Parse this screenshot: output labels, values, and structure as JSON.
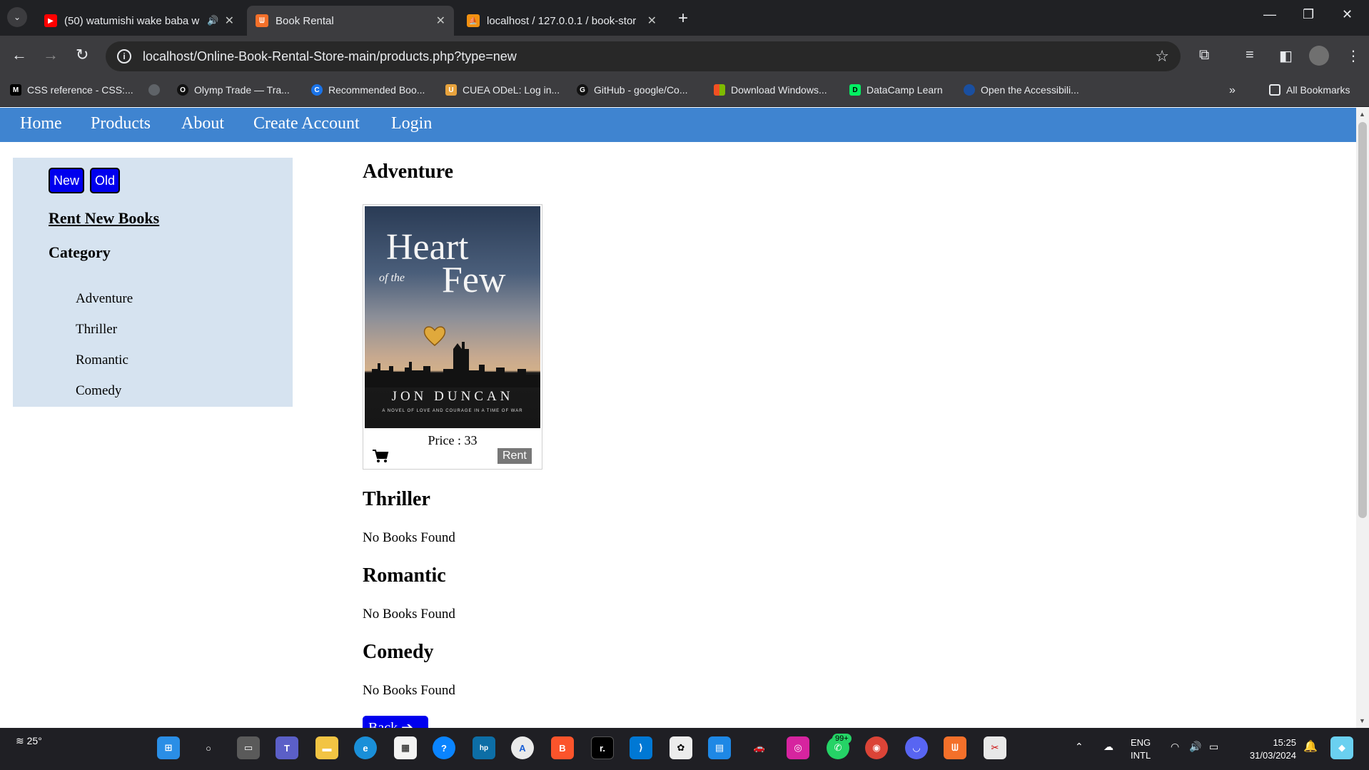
{
  "browser": {
    "tabs": [
      {
        "title": "(50) watumishi wake baba w",
        "favicon_color": "#ff0000"
      },
      {
        "title": "Book Rental",
        "favicon_color": "#f4702a"
      },
      {
        "title": "localhost / 127.0.0.1 / book-stor",
        "favicon_color": "#f29111"
      }
    ],
    "url": "localhost/Online-Book-Rental-Store-main/products.php?type=new",
    "bookmarks": [
      {
        "label": "CSS reference - CSS:...",
        "icon": "M",
        "color": "#000000"
      },
      {
        "label": "Olymp Trade — Tra...",
        "icon": "O",
        "color": "#111111"
      },
      {
        "label": "Recommended Boo...",
        "icon": "C",
        "color": "#1a73e8"
      },
      {
        "label": "CUEA ODeL: Log in...",
        "icon": "U",
        "color": "#e8a33d"
      },
      {
        "label": "GitHub - google/Co...",
        "icon": "G",
        "color": "#111111"
      },
      {
        "label": "Download Windows...",
        "icon": "W",
        "color": "#f25022"
      },
      {
        "label": "DataCamp Learn",
        "icon": "D",
        "color": "#03ef62"
      },
      {
        "label": "Open the Accessibili...",
        "icon": "A",
        "color": "#1a4fa0"
      }
    ],
    "all_bookmarks": "All Bookmarks"
  },
  "nav": {
    "home": "Home",
    "products": "Products",
    "about": "About",
    "create_account": "Create Account",
    "login": "Login"
  },
  "sidebar": {
    "btn_new": "New",
    "btn_old": "Old",
    "rent_link": "Rent New Books",
    "category_title": "Category",
    "categories": [
      "Adventure",
      "Thriller",
      "Romantic",
      "Comedy"
    ]
  },
  "sections": [
    {
      "heading": "Adventure"
    },
    {
      "heading": "Thriller",
      "empty_text": "No Books Found"
    },
    {
      "heading": "Romantic",
      "empty_text": "No Books Found"
    },
    {
      "heading": "Comedy",
      "empty_text": "No Books Found"
    }
  ],
  "book": {
    "cover_title_line1": "Heart",
    "cover_title_line2": "of the",
    "cover_title_line3": "Few",
    "cover_author": "JON DUNCAN",
    "cover_tagline": "A NOVEL OF LOVE AND COURAGE IN A TIME OF WAR",
    "price_text": "Price : 33",
    "rent_label": "Rent"
  },
  "back_button": "Back",
  "taskbar": {
    "weather": "25°",
    "badge": "99+",
    "lang1": "ENG",
    "lang2": "INTL",
    "time": "15:25",
    "date": "31/03/2024"
  },
  "colors": {
    "nav_bg": "#3f84d0",
    "sidebar_bg": "#d6e3f0",
    "button_blue": "#0000ee",
    "rent_grey": "#777777"
  }
}
